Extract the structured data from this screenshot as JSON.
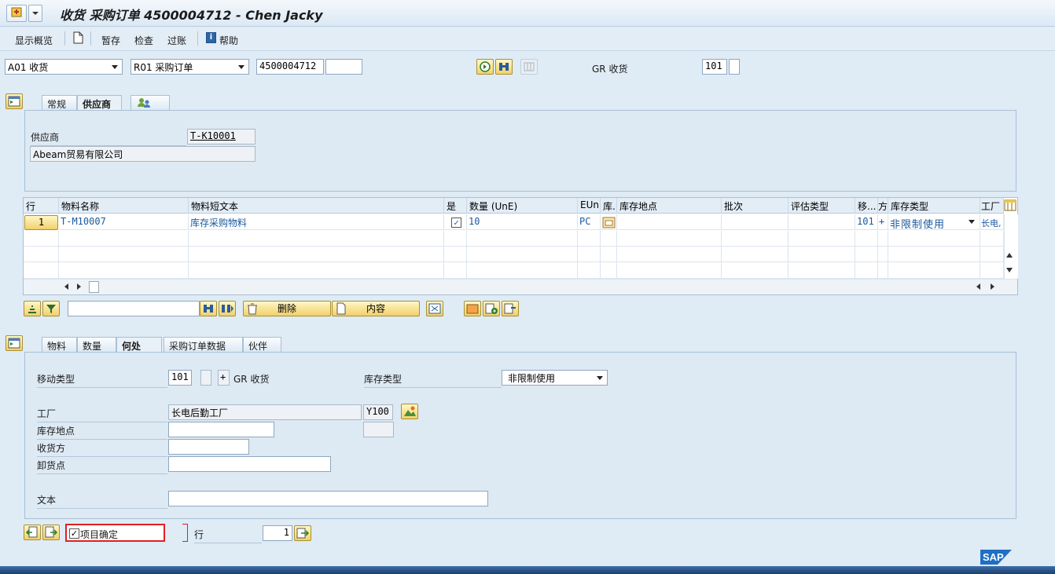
{
  "window": {
    "title": "收货 采购订单 4500004712 - Chen Jacky"
  },
  "toolbar": {
    "overview": "显示概览",
    "hold": "暂存",
    "check": "检查",
    "post": "过账",
    "help": "帮助"
  },
  "header": {
    "transaction": "A01 收货",
    "reference": "R01 采购订单",
    "po_number": "4500004712",
    "po_item": "",
    "mvt_label": "GR 收货",
    "mvt_type": "101",
    "mvt_special": ""
  },
  "header_tabs": [
    "常规",
    "供应商"
  ],
  "vendor": {
    "label": "供应商",
    "id": "T-K10001",
    "name": "Abeam贸易有限公司"
  },
  "grid": {
    "columns": [
      "行",
      "物料名称",
      "物料短文本",
      "是",
      "数量 (UnE)",
      "EUn",
      "库...",
      "库存地点",
      "批次",
      "评估类型",
      "移...",
      "方",
      "库存类型",
      "工厂"
    ],
    "rows": [
      {
        "line": "1",
        "material": "T-M10007",
        "text": "库存采购物料",
        "ok": "✓",
        "qty": "10",
        "uom": "PC",
        "sloc": "",
        "batch": "",
        "val": "",
        "mvt": "101",
        "sign": "+",
        "stype": "非限制使用",
        "plant": "长电,"
      }
    ]
  },
  "grid_actions": {
    "delete": "删除",
    "content": "内容"
  },
  "detail_tabs": [
    "物料",
    "数量",
    "何处",
    "采购订单数据",
    "伙伴"
  ],
  "detail": {
    "mvt_label": "移动类型",
    "mvt": "101",
    "sign": "+",
    "mvt_text": "GR 收货",
    "stype_label": "库存类型",
    "stype": "非限制使用",
    "plant_label": "工厂",
    "plant_name": "长电后勤工厂",
    "plant": "Y100",
    "sloc_label": "库存地点",
    "recipient_label": "收货方",
    "unload_label": "卸货点",
    "text_label": "文本"
  },
  "footer": {
    "confirm": "项目确定",
    "line_label": "行",
    "line": "1"
  },
  "brand": "SAP"
}
